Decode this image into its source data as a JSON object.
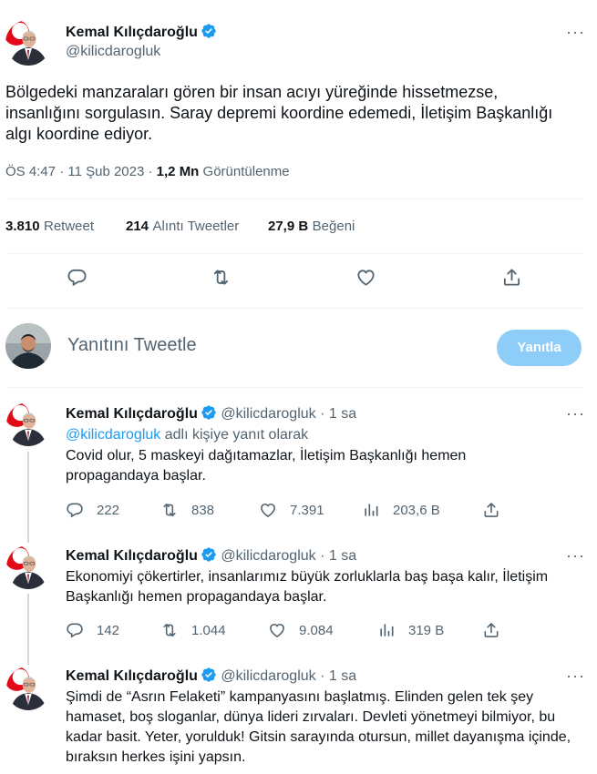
{
  "main_tweet": {
    "author_name": "Kemal Kılıçdaroğlu",
    "handle": "@kilicdarogluk",
    "text": "Bölgedeki manzaraları gören bir insan acıyı yüreğinde hissetmezse, insanlığını sorgulasın. Saray depremi koordine edemedi, İletişim Başkanlığı algı koordine ediyor.",
    "time": "ÖS 4:47 · 11 Şub 2023 ·",
    "views_count": "1,2 Mn",
    "views_label": "Görüntülenme",
    "retweets_count": "3.810",
    "retweets_label": "Retweet",
    "quotes_count": "214",
    "quotes_label": "Alıntı Tweetler",
    "likes_count": "27,9 B",
    "likes_label": "Beğeni",
    "more_label": "···"
  },
  "composer": {
    "placeholder": "Yanıtını Tweetle",
    "button_label": "Yanıtla"
  },
  "replies": [
    {
      "author_name": "Kemal Kılıçdaroğlu",
      "handle": "@kilicdarogluk",
      "time": "· 1 sa",
      "replying_handle": "@kilicdarogluk",
      "replying_suffix": " adlı kişiye yanıt olarak",
      "text": "Covid olur, 5 maskeyi dağıtamazlar, İletişim Başkanlığı hemen propagandaya başlar.",
      "replies_count": "222",
      "retweets_count": "838",
      "likes_count": "7.391",
      "views_count": "203,6 B",
      "more_label": "···"
    },
    {
      "author_name": "Kemal Kılıçdaroğlu",
      "handle": "@kilicdarogluk",
      "time": "· 1 sa",
      "text": "Ekonomiyi çökertirler, insanlarımız büyük zorluklarla baş başa kalır, İletişim Başkanlığı hemen propagandaya başlar.",
      "replies_count": "142",
      "retweets_count": "1.044",
      "likes_count": "9.084",
      "views_count": "319 B",
      "more_label": "···"
    },
    {
      "author_name": "Kemal Kılıçdaroğlu",
      "handle": "@kilicdarogluk",
      "time": "· 1 sa",
      "text": "Şimdi de “Asrın Felaketi” kampanyasını başlatmış. Elinden gelen tek şey hamaset, boş sloganlar, dünya lideri zırvaları. Devleti yönetmeyi bilmiyor, bu kadar basit. Yeter, yorulduk! Gitsin sarayında otursun, millet dayanışma içinde, bıraksın herkes işini yapsın.",
      "more_label": "···"
    }
  ],
  "colors": {
    "accent": "#1d9bf0",
    "reply_button_disabled": "#8ecdf7",
    "text_primary": "#0f1419",
    "text_secondary": "#536471",
    "divider": "#eff3f4"
  }
}
